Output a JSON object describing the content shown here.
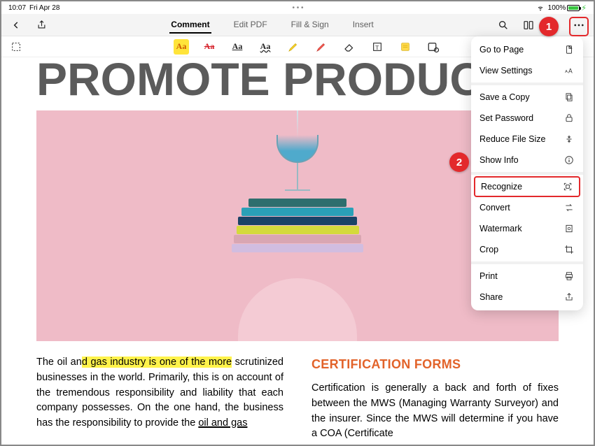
{
  "status": {
    "time": "10:07",
    "date": "Fri Apr 28",
    "battery_pct": "100%"
  },
  "tabs": {
    "comment": "Comment",
    "edit": "Edit PDF",
    "fill": "Fill & Sign",
    "insert": "Insert"
  },
  "callouts": {
    "b1": "1",
    "b2": "2"
  },
  "menu": {
    "go_to_page": "Go to Page",
    "view_settings": "View Settings",
    "save_copy": "Save a Copy",
    "set_password": "Set Password",
    "reduce": "Reduce File Size",
    "show_info": "Show Info",
    "recognize": "Recognize",
    "convert": "Convert",
    "watermark": "Watermark",
    "crop": "Crop",
    "print": "Print",
    "share": "Share"
  },
  "tool_icons": {
    "highlight": "Aa",
    "strikethrough": "Aa",
    "underline": "Aa",
    "squiggly": "Aa"
  },
  "doc": {
    "big_title": "PROMOTE PRODUCTIV",
    "left_pre": "The oil an",
    "left_hl": "d gas industry is one of the more",
    "left_rest": " scrutinized businesses in the world. Primarily, this is on account of the tremendous responsibility and liability that each company possesses. On the one hand, the business has the responsibility to provide the ",
    "left_tail": "oil and gas",
    "sub_head": "CERTIFICATION FORMS",
    "right": "Certification is generally a back and forth of fixes between the MWS (Managing Warranty Surveyor) and the insurer. Since the MWS will determine if you have a COA (Certificate"
  }
}
